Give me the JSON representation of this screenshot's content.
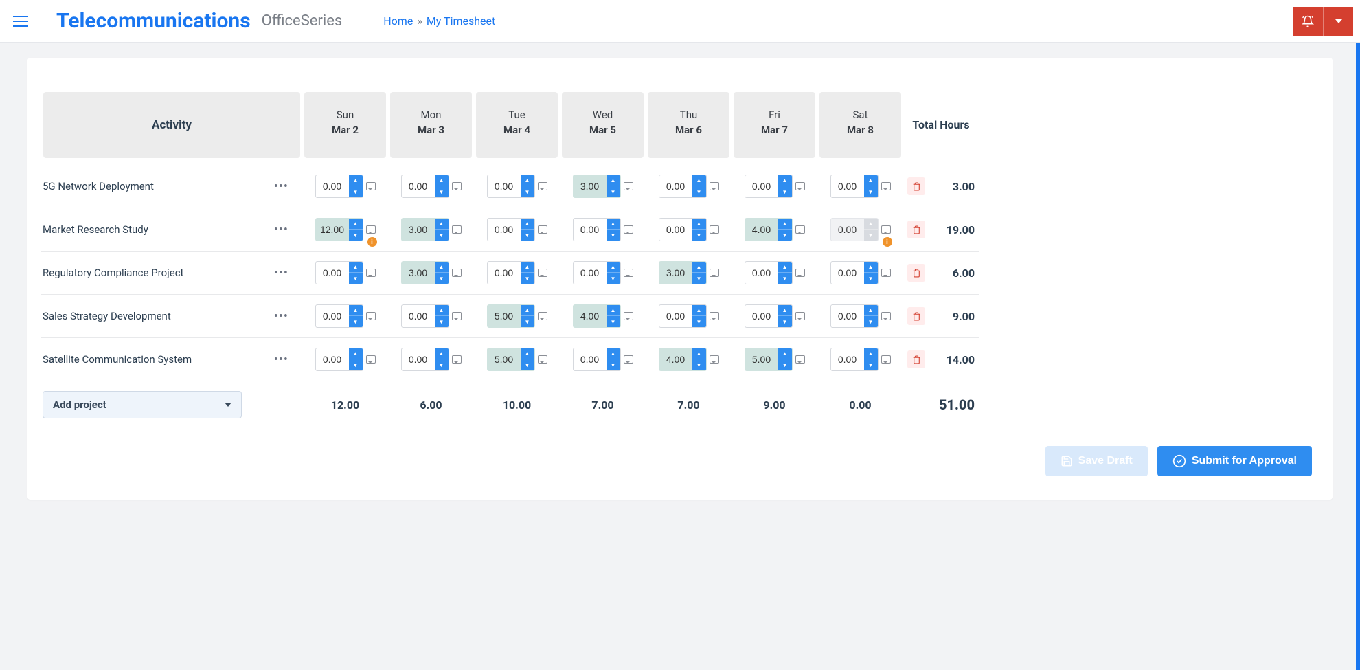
{
  "header": {
    "brand": "Telecommunications",
    "series": "OfficeSeries",
    "breadcrumb": {
      "home": "Home",
      "current": "My Timesheet"
    }
  },
  "table": {
    "activity_header": "Activity",
    "total_header": "Total Hours",
    "days": [
      {
        "dow": "Sun",
        "date": "Mar 2"
      },
      {
        "dow": "Mon",
        "date": "Mar 3"
      },
      {
        "dow": "Tue",
        "date": "Mar 4"
      },
      {
        "dow": "Wed",
        "date": "Mar 5"
      },
      {
        "dow": "Thu",
        "date": "Mar 6"
      },
      {
        "dow": "Fri",
        "date": "Mar 7"
      },
      {
        "dow": "Sat",
        "date": "Mar 8"
      }
    ],
    "rows": [
      {
        "name": "5G Network Deployment",
        "cells": [
          {
            "val": "0.00"
          },
          {
            "val": "0.00"
          },
          {
            "val": "0.00"
          },
          {
            "val": "3.00",
            "filled": true
          },
          {
            "val": "0.00"
          },
          {
            "val": "0.00"
          },
          {
            "val": "0.00"
          }
        ],
        "total": "3.00"
      },
      {
        "name": "Market Research Study",
        "cells": [
          {
            "val": "12.00",
            "filled": true,
            "warn": true
          },
          {
            "val": "3.00",
            "filled": true
          },
          {
            "val": "0.00"
          },
          {
            "val": "0.00"
          },
          {
            "val": "0.00"
          },
          {
            "val": "4.00",
            "filled": true
          },
          {
            "val": "0.00",
            "disabled": true,
            "warn": true
          }
        ],
        "total": "19.00"
      },
      {
        "name": "Regulatory Compliance Project",
        "cells": [
          {
            "val": "0.00"
          },
          {
            "val": "3.00",
            "filled": true
          },
          {
            "val": "0.00"
          },
          {
            "val": "0.00"
          },
          {
            "val": "3.00",
            "filled": true
          },
          {
            "val": "0.00"
          },
          {
            "val": "0.00"
          }
        ],
        "total": "6.00"
      },
      {
        "name": "Sales Strategy Development",
        "cells": [
          {
            "val": "0.00"
          },
          {
            "val": "0.00"
          },
          {
            "val": "5.00",
            "filled": true
          },
          {
            "val": "4.00",
            "filled": true
          },
          {
            "val": "0.00"
          },
          {
            "val": "0.00"
          },
          {
            "val": "0.00"
          }
        ],
        "total": "9.00"
      },
      {
        "name": "Satellite Communication System",
        "cells": [
          {
            "val": "0.00"
          },
          {
            "val": "0.00"
          },
          {
            "val": "5.00",
            "filled": true
          },
          {
            "val": "0.00"
          },
          {
            "val": "4.00",
            "filled": true
          },
          {
            "val": "5.00",
            "filled": true
          },
          {
            "val": "0.00"
          }
        ],
        "total": "14.00"
      }
    ],
    "column_totals": [
      "12.00",
      "6.00",
      "10.00",
      "7.00",
      "7.00",
      "9.00",
      "0.00"
    ],
    "grand_total": "51.00",
    "add_project": "Add project"
  },
  "actions": {
    "save_draft": "Save Draft",
    "submit": "Submit for Approval"
  }
}
